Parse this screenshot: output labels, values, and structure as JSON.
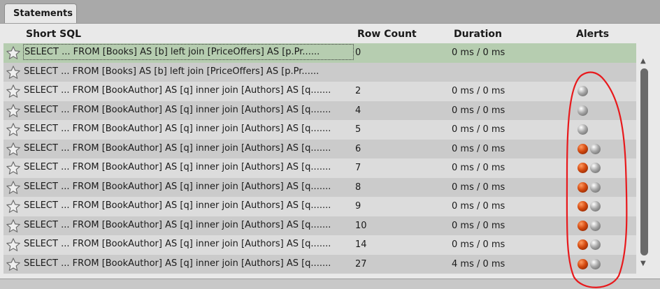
{
  "tab": {
    "label": "Statements"
  },
  "columns": {
    "sql": "Short SQL",
    "row_count": "Row Count",
    "duration": "Duration",
    "alerts": "Alerts"
  },
  "rows": [
    {
      "sql": "SELECT ... FROM [Books] AS [b] left join [PriceOffers] AS [p.Pr......",
      "row_count": "0",
      "duration": "0 ms / 0 ms",
      "alerts": [],
      "selected": true
    },
    {
      "sql": "SELECT ... FROM [Books] AS [b] left join [PriceOffers] AS [p.Pr......",
      "row_count": "",
      "duration": "",
      "alerts": []
    },
    {
      "sql": "SELECT ... FROM [BookAuthor] AS [q] inner join [Authors] AS [q.......",
      "row_count": "2",
      "duration": "0 ms / 0 ms",
      "alerts": [
        "grey"
      ]
    },
    {
      "sql": "SELECT ... FROM [BookAuthor] AS [q] inner join [Authors] AS [q.......",
      "row_count": "4",
      "duration": "0 ms / 0 ms",
      "alerts": [
        "grey"
      ]
    },
    {
      "sql": "SELECT ... FROM [BookAuthor] AS [q] inner join [Authors] AS [q.......",
      "row_count": "5",
      "duration": "0 ms / 0 ms",
      "alerts": [
        "grey"
      ]
    },
    {
      "sql": "SELECT ... FROM [BookAuthor] AS [q] inner join [Authors] AS [q.......",
      "row_count": "6",
      "duration": "0 ms / 0 ms",
      "alerts": [
        "red",
        "grey"
      ]
    },
    {
      "sql": "SELECT ... FROM [BookAuthor] AS [q] inner join [Authors] AS [q.......",
      "row_count": "7",
      "duration": "0 ms / 0 ms",
      "alerts": [
        "red",
        "grey"
      ]
    },
    {
      "sql": "SELECT ... FROM [BookAuthor] AS [q] inner join [Authors] AS [q.......",
      "row_count": "8",
      "duration": "0 ms / 0 ms",
      "alerts": [
        "red",
        "grey"
      ]
    },
    {
      "sql": "SELECT ... FROM [BookAuthor] AS [q] inner join [Authors] AS [q.......",
      "row_count": "9",
      "duration": "0 ms / 0 ms",
      "alerts": [
        "red",
        "grey"
      ]
    },
    {
      "sql": "SELECT ... FROM [BookAuthor] AS [q] inner join [Authors] AS [q.......",
      "row_count": "10",
      "duration": "0 ms / 0 ms",
      "alerts": [
        "red",
        "grey"
      ]
    },
    {
      "sql": "SELECT ... FROM [BookAuthor] AS [q] inner join [Authors] AS [q.......",
      "row_count": "14",
      "duration": "0 ms / 0 ms",
      "alerts": [
        "red",
        "grey"
      ]
    },
    {
      "sql": "SELECT ... FROM [BookAuthor] AS [q] inner join [Authors] AS [q.......",
      "row_count": "27",
      "duration": "4 ms / 0 ms",
      "alerts": [
        "red",
        "grey"
      ]
    }
  ],
  "icons": {
    "row": "star-icon",
    "alert_red": "red-alert-dot-icon",
    "alert_grey": "grey-alert-dot-icon",
    "scroll_up": "scroll-up-arrow-icon",
    "scroll_down": "scroll-down-arrow-icon"
  },
  "colors": {
    "selected_row": "#b6cdb0",
    "alert_red": "#d44a10",
    "alert_grey": "#a8a8a8",
    "annotation": "#e8191c"
  }
}
